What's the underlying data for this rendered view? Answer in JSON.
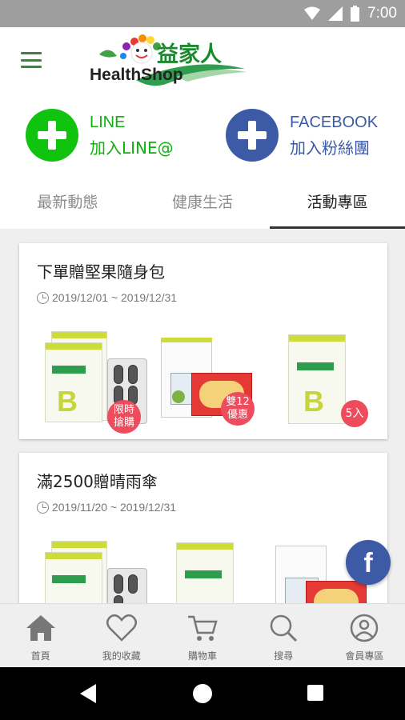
{
  "status_bar": {
    "time": "7:00"
  },
  "header": {
    "menu_icon": "hamburger-menu-icon",
    "logo_cn": "益家人",
    "logo_en": "HealthShop"
  },
  "social": {
    "line": {
      "title": "LINE",
      "subtitle": "加入LINE@",
      "color": "#10c30f",
      "icon": "plus-icon"
    },
    "facebook": {
      "title": "FACEBOOK",
      "subtitle": "加入粉絲團",
      "color": "#3c5aa6",
      "icon": "plus-icon"
    }
  },
  "tabs": [
    {
      "label": "最新動態",
      "active": false
    },
    {
      "label": "健康生活",
      "active": false
    },
    {
      "label": "活動專區",
      "active": true
    }
  ],
  "cards": [
    {
      "title": "下單贈堅果隨身包",
      "date": "2019/12/01 ~ 2019/12/31",
      "badges": [
        "限時\n搶購",
        "雙12\n優惠",
        "5入"
      ]
    },
    {
      "title": "滿2500贈晴雨傘",
      "date": "2019/11/20 ~ 2019/12/31"
    }
  ],
  "floating": {
    "facebook_label": "f"
  },
  "bottom_nav": [
    {
      "label": "首頁",
      "icon": "home-icon"
    },
    {
      "label": "我的收藏",
      "icon": "heart-icon"
    },
    {
      "label": "購物車",
      "icon": "cart-icon"
    },
    {
      "label": "搜尋",
      "icon": "search-icon"
    },
    {
      "label": "會員專區",
      "icon": "user-icon"
    }
  ],
  "colors": {
    "accent_red": "#ee4b5c",
    "brand_green": "#1b8a2e",
    "facebook_blue": "#3c5aa6",
    "line_green": "#10c30f"
  }
}
